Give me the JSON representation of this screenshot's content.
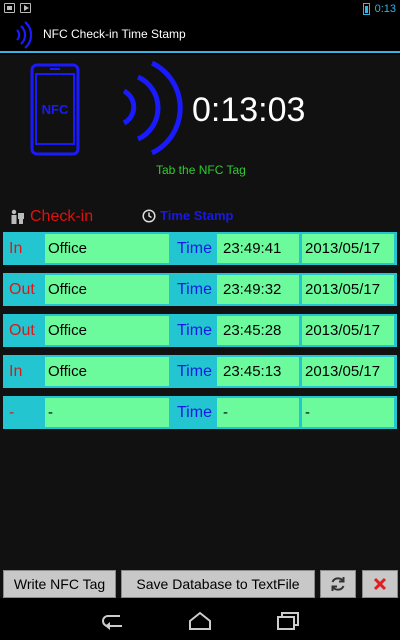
{
  "status_bar": {
    "time": "0:13"
  },
  "action_bar": {
    "title": "NFC Check-in Time Stamp",
    "icon": "nfc-waves-icon"
  },
  "hero": {
    "phone_label": "NFC",
    "clock": "0:13:03",
    "hint": "Tab the NFC Tag"
  },
  "columns": {
    "checkin": "Check-in",
    "time_stamp": "Time Stamp"
  },
  "rows": [
    {
      "type": "In",
      "place": "Office",
      "time_label": "Time",
      "time": "23:49:41",
      "date": "2013/05/17"
    },
    {
      "type": "Out",
      "place": "Office",
      "time_label": "Time",
      "time": "23:49:32",
      "date": "2013/05/17"
    },
    {
      "type": "Out",
      "place": "Office",
      "time_label": "Time",
      "time": "23:45:28",
      "date": "2013/05/17"
    },
    {
      "type": "In",
      "place": "Office",
      "time_label": "Time",
      "time": "23:45:13",
      "date": "2013/05/17"
    },
    {
      "type": "-",
      "place": "-",
      "time_label": "Time",
      "time": "-",
      "date": "-"
    }
  ],
  "buttons": {
    "write": "Write NFC Tag",
    "save": "Save Database to TextFile",
    "refresh_icon": "refresh-icon",
    "close_icon": "close-icon"
  },
  "colors": {
    "accent": "#33b5e5",
    "row_bg": "#23c6d0",
    "cell_bg": "#6cfb9c",
    "checkin_red": "#e01010",
    "time_blue": "#1818e8",
    "hint_green": "#2fcc2f"
  }
}
